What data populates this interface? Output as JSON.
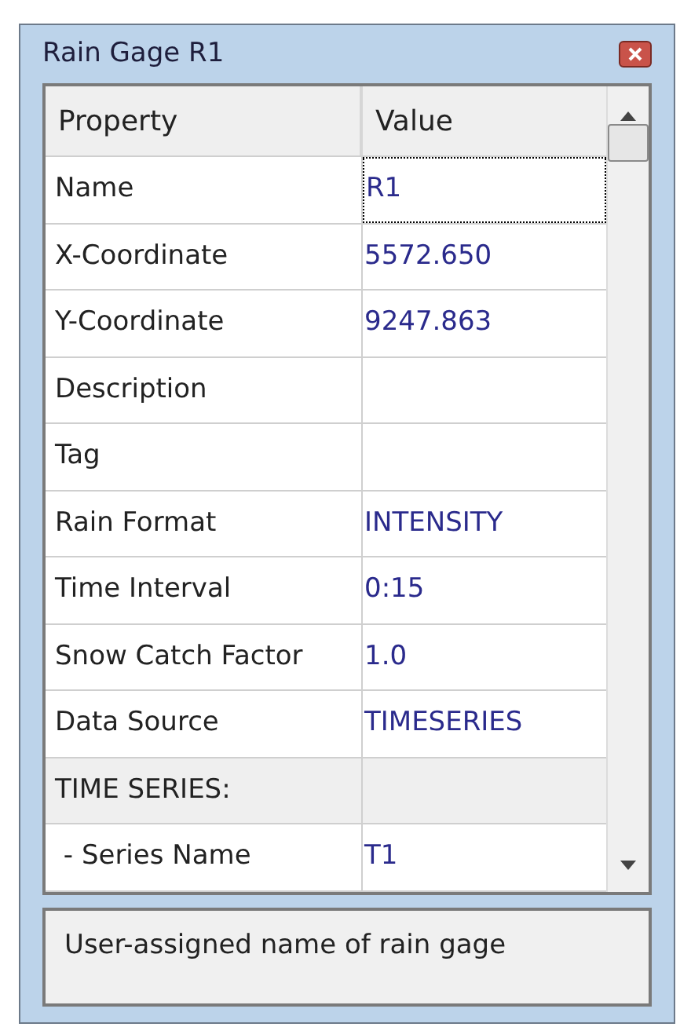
{
  "window": {
    "title": "Rain Gage R1"
  },
  "table": {
    "columns": [
      "Property",
      "Value"
    ],
    "rows": [
      {
        "kind": "property",
        "property": "Name",
        "value": "R1",
        "selected": true
      },
      {
        "kind": "property",
        "property": "X-Coordinate",
        "value": "5572.650",
        "selected": false
      },
      {
        "kind": "property",
        "property": "Y-Coordinate",
        "value": "9247.863",
        "selected": false
      },
      {
        "kind": "property",
        "property": "Description",
        "selected": false
      },
      {
        "kind": "property",
        "property": "Tag",
        "selected": false
      },
      {
        "kind": "property",
        "property": "Rain Format",
        "value": "INTENSITY",
        "selected": false
      },
      {
        "kind": "property",
        "property": "Time Interval",
        "value": "0:15",
        "selected": false
      },
      {
        "kind": "property",
        "property": "Snow Catch Factor",
        "value": "1.0",
        "selected": false
      },
      {
        "kind": "property",
        "property": "Data Source",
        "value": "TIMESERIES",
        "selected": false
      },
      {
        "kind": "section",
        "property": "TIME SERIES:",
        "selected": false
      },
      {
        "kind": "property",
        "property": " - Series Name",
        "value": "T1",
        "selected": false
      }
    ]
  },
  "description": "User-assigned name of rain gage"
}
